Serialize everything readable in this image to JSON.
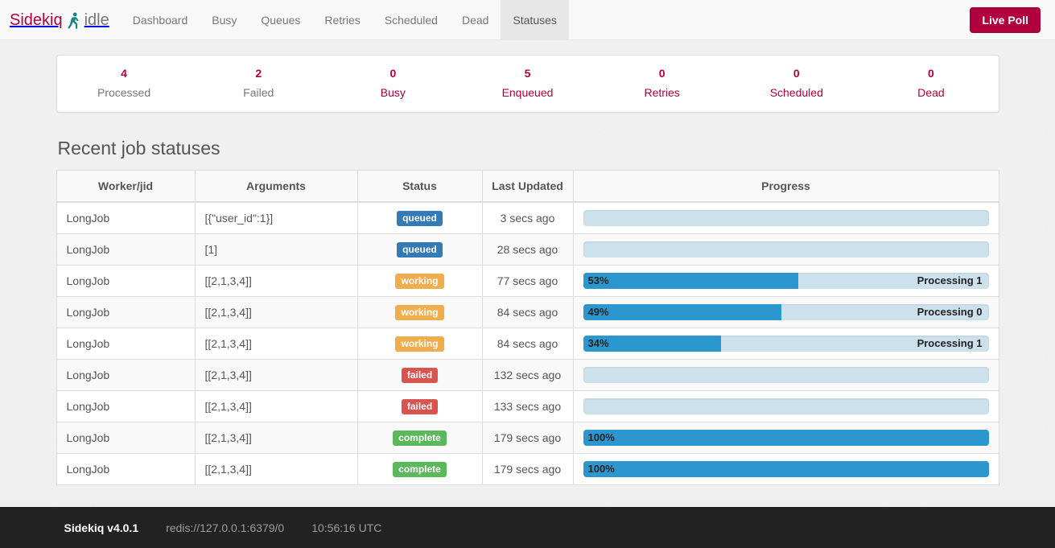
{
  "navbar": {
    "brand_name": "Sidekiq",
    "brand_glyph": "sidekiq-runner-icon",
    "brand_status": "idle",
    "links": [
      {
        "label": "Dashboard",
        "active": false
      },
      {
        "label": "Busy",
        "active": false
      },
      {
        "label": "Queues",
        "active": false
      },
      {
        "label": "Retries",
        "active": false
      },
      {
        "label": "Scheduled",
        "active": false
      },
      {
        "label": "Dead",
        "active": false
      },
      {
        "label": "Statuses",
        "active": true
      }
    ],
    "live_poll_label": "Live Poll"
  },
  "colors": {
    "brand": "#b1003e",
    "queued": "#337ab7",
    "working": "#f0ad4e",
    "failed": "#d9534f",
    "complete": "#5cb85c",
    "progress_fill": "#2c97ce",
    "progress_track": "#cde1ed",
    "footer_bg": "#222222",
    "page_bg": "#f0f0f0"
  },
  "stats": [
    {
      "value": "4",
      "label": "Processed",
      "muted": true
    },
    {
      "value": "2",
      "label": "Failed",
      "muted": true
    },
    {
      "value": "0",
      "label": "Busy",
      "muted": false
    },
    {
      "value": "5",
      "label": "Enqueued",
      "muted": false
    },
    {
      "value": "0",
      "label": "Retries",
      "muted": false
    },
    {
      "value": "0",
      "label": "Scheduled",
      "muted": false
    },
    {
      "value": "0",
      "label": "Dead",
      "muted": false
    }
  ],
  "main": {
    "heading": "Recent job statuses",
    "table": {
      "columns": [
        "Worker/jid",
        "Arguments",
        "Status",
        "Last Updated",
        "Progress"
      ],
      "rows": [
        {
          "worker": "LongJob",
          "arguments": "[{\"user_id\":1}]",
          "status": "queued",
          "last_updated": "3 secs ago",
          "progress_pct": 0,
          "progress_label": "",
          "progress_message": ""
        },
        {
          "worker": "LongJob",
          "arguments": "[1]",
          "status": "queued",
          "last_updated": "28 secs ago",
          "progress_pct": 0,
          "progress_label": "",
          "progress_message": ""
        },
        {
          "worker": "LongJob",
          "arguments": "[[2,1,3,4]]",
          "status": "working",
          "last_updated": "77 secs ago",
          "progress_pct": 53,
          "progress_label": "53%",
          "progress_message": "Processing 1"
        },
        {
          "worker": "LongJob",
          "arguments": "[[2,1,3,4]]",
          "status": "working",
          "last_updated": "84 secs ago",
          "progress_pct": 49,
          "progress_label": "49%",
          "progress_message": "Processing 0"
        },
        {
          "worker": "LongJob",
          "arguments": "[[2,1,3,4]]",
          "status": "working",
          "last_updated": "84 secs ago",
          "progress_pct": 34,
          "progress_label": "34%",
          "progress_message": "Processing 1"
        },
        {
          "worker": "LongJob",
          "arguments": "[[2,1,3,4]]",
          "status": "failed",
          "last_updated": "132 secs ago",
          "progress_pct": 0,
          "progress_label": "",
          "progress_message": ""
        },
        {
          "worker": "LongJob",
          "arguments": "[[2,1,3,4]]",
          "status": "failed",
          "last_updated": "133 secs ago",
          "progress_pct": 0,
          "progress_label": "",
          "progress_message": ""
        },
        {
          "worker": "LongJob",
          "arguments": "[[2,1,3,4]]",
          "status": "complete",
          "last_updated": "179 secs ago",
          "progress_pct": 100,
          "progress_label": "100%",
          "progress_message": ""
        },
        {
          "worker": "LongJob",
          "arguments": "[[2,1,3,4]]",
          "status": "complete",
          "last_updated": "179 secs ago",
          "progress_pct": 100,
          "progress_label": "100%",
          "progress_message": ""
        }
      ]
    }
  },
  "footer": {
    "version": "Sidekiq v4.0.1",
    "redis": "redis://127.0.0.1:6379/0",
    "time": "10:56:16 UTC"
  }
}
